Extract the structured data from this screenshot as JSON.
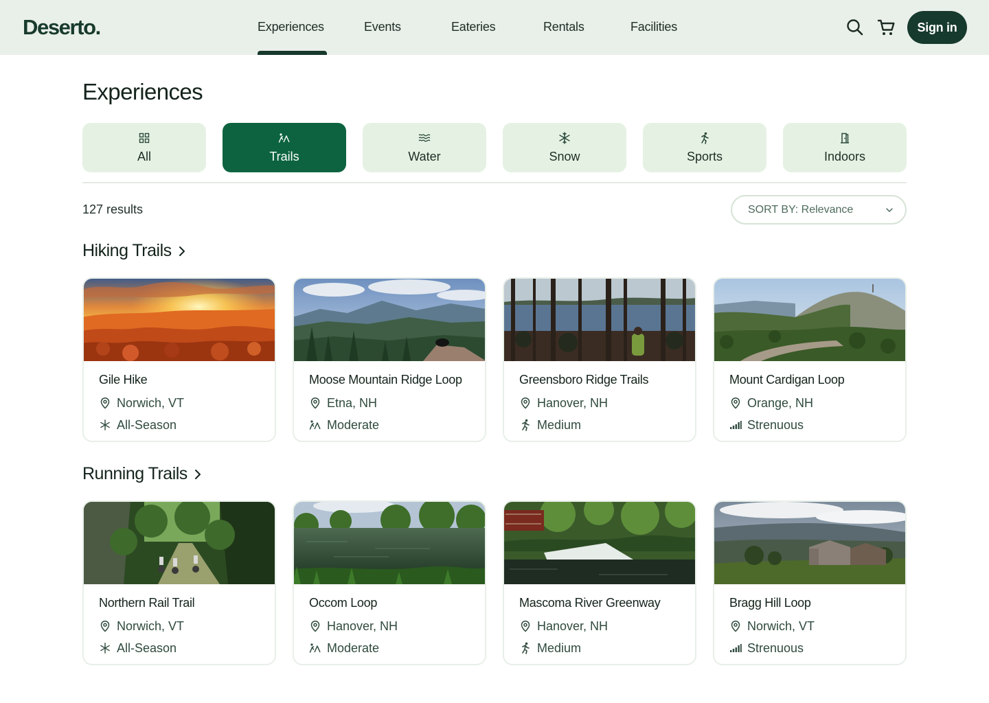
{
  "brand": {
    "name": "Deserto."
  },
  "nav": {
    "items": [
      "Experiences",
      "Events",
      "Eateries",
      "Rentals",
      "Facilities"
    ],
    "active": "Experiences",
    "sign_in": "Sign in"
  },
  "page": {
    "title": "Experiences",
    "categories": [
      {
        "label": "All",
        "icon": "grid-icon"
      },
      {
        "label": "Trails",
        "icon": "hiker-icon",
        "active": true
      },
      {
        "label": "Water",
        "icon": "waves-icon"
      },
      {
        "label": "Snow",
        "icon": "snowflake-icon"
      },
      {
        "label": "Sports",
        "icon": "runner-icon"
      },
      {
        "label": "Indoors",
        "icon": "door-icon"
      }
    ],
    "results": "127 results",
    "sort_label": "SORT BY: Relevance"
  },
  "sections": [
    {
      "title": "Hiking Trails",
      "cards": [
        {
          "name": "Gile Hike",
          "location": "Norwich, VT",
          "tag": "All-Season",
          "tag_icon": "snowflake-icon",
          "photo": "sunset-forest"
        },
        {
          "name": "Moose Mountain Ridge Loop",
          "location": "Etna, NH",
          "tag": "Moderate",
          "tag_icon": "hiker-icon",
          "photo": "mountain-ridge"
        },
        {
          "name": "Greensboro Ridge Trails",
          "location": "Hanover, NH",
          "tag": "Medium",
          "tag_icon": "runner-icon",
          "photo": "forest-lake"
        },
        {
          "name": "Mount Cardigan Loop",
          "location": "Orange, NH",
          "tag": "Strenuous",
          "tag_icon": "signal-bars-icon",
          "photo": "summit-path"
        }
      ]
    },
    {
      "title": "Running Trails",
      "cards": [
        {
          "name": "Northern Rail Trail",
          "location": "Norwich, VT",
          "tag": "All-Season",
          "tag_icon": "snowflake-icon",
          "photo": "forest-cyclists"
        },
        {
          "name": "Occom Loop",
          "location": "Hanover, NH",
          "tag": "Moderate",
          "tag_icon": "hiker-icon",
          "photo": "pond-shore"
        },
        {
          "name": "Mascoma River Greenway",
          "location": "Hanover, NH",
          "tag": "Medium",
          "tag_icon": "runner-icon",
          "photo": "river-dam"
        },
        {
          "name": "Bragg Hill Loop",
          "location": "Norwich, VT",
          "tag": "Strenuous",
          "tag_icon": "signal-bars-icon",
          "photo": "barn-valley"
        }
      ]
    }
  ],
  "colors": {
    "header_bg": "#e9efe9",
    "brand_dark": "#163a2d",
    "accent_green": "#0d6340",
    "chip_bg": "#e5f2e3"
  }
}
